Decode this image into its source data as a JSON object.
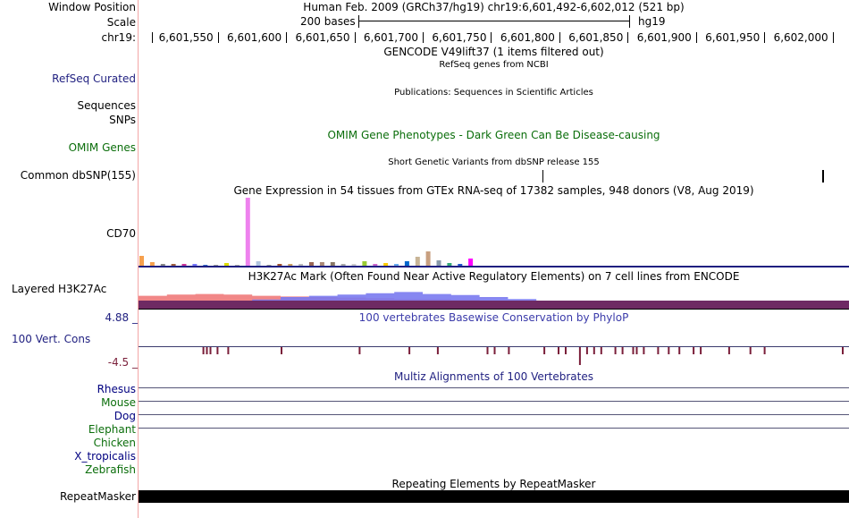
{
  "header": {
    "window_position_label": "Window Position",
    "window_position_value": "Human Feb. 2009 (GRCh37/hg19)   chr19:6,601,492-6,602,012 (521 bp)",
    "scale_label": "Scale",
    "scale_text": "200 bases",
    "scale_assembly": "hg19",
    "chrom_label": "chr19:",
    "ticks": [
      {
        "pos": 6601550,
        "label": "6,601,550"
      },
      {
        "pos": 6601600,
        "label": "6,601,600"
      },
      {
        "pos": 6601650,
        "label": "6,601,650"
      },
      {
        "pos": 6601700,
        "label": "6,601,700"
      },
      {
        "pos": 6601750,
        "label": "6,601,750"
      },
      {
        "pos": 6601800,
        "label": "6,601,800"
      },
      {
        "pos": 6601850,
        "label": "6,601,850"
      },
      {
        "pos": 6601900,
        "label": "6,601,900"
      },
      {
        "pos": 6601950,
        "label": "6,601,950"
      },
      {
        "pos": 6602000,
        "label": "6,602,000"
      }
    ]
  },
  "tracks": {
    "gencode_title": "GENCODE V49lift37 (1 items filtered out)",
    "refseq_title": "RefSeq genes from NCBI",
    "refseq_label": "RefSeq Curated",
    "publications_title": "Publications: Sequences in Scientific Articles",
    "sequences_label": "Sequences",
    "snps_label": "SNPs",
    "omim_title": "OMIM Gene Phenotypes - Dark Green Can Be Disease-causing",
    "omim_label": "OMIM Genes",
    "dbsnp_title": "Short Genetic Variants from dbSNP release 155",
    "dbsnp_label": "Common dbSNP(155)",
    "gtex_title": "Gene Expression in 54 tissues from GTEx RNA-seq of 17382 samples, 948 donors (V8, Aug 2019)",
    "gtex_label": "CD70",
    "h3k27ac_title": "H3K27Ac Mark (Often Found Near Active Regulatory Elements) on 7 cell lines from ENCODE",
    "h3k27ac_label": "Layered H3K27Ac",
    "cons_title": "100 vertebrates Basewise Conservation by PhyloP",
    "cons_label": "100 Vert. Cons",
    "cons_max": "4.88 _",
    "cons_min": "-4.5 _",
    "multiz_title": "Multiz Alignments of 100 Vertebrates",
    "species": [
      {
        "name": "Rhesus",
        "color": "#000080",
        "line": true
      },
      {
        "name": "Mouse",
        "color": "#0b6e0b",
        "line": true
      },
      {
        "name": "Dog",
        "color": "#000080",
        "line": true
      },
      {
        "name": "Elephant",
        "color": "#0b6e0b",
        "line": true
      },
      {
        "name": "Chicken",
        "color": "#0b6e0b",
        "line": false
      },
      {
        "name": "X_tropicalis",
        "color": "#000080",
        "line": false
      },
      {
        "name": "Zebrafish",
        "color": "#0b6e0b",
        "line": false
      }
    ],
    "repeat_title": "Repeating Elements by RepeatMasker",
    "repeat_label": "RepeatMasker"
  },
  "colors": {
    "navy_label": "#1f1f80",
    "green_label": "#0b6e0b",
    "conservation": "#3b3baa",
    "h3k27ac_red": "#f07a7a",
    "h3k27ac_blue": "#7a7af0",
    "h3k27ac_dark": "#6e2a63"
  },
  "gtex_bars": [
    {
      "v": 11,
      "c": "#f6a04d"
    },
    {
      "v": 4,
      "c": "#f6a04d"
    },
    {
      "v": 2,
      "c": "#888888"
    },
    {
      "v": 2,
      "c": "#a06040"
    },
    {
      "v": 2,
      "c": "#cc3399"
    },
    {
      "v": 2,
      "c": "#7777ff"
    },
    {
      "v": 1,
      "c": "#3366cc"
    },
    {
      "v": 1,
      "c": "#999999"
    },
    {
      "v": 3,
      "c": "#dddd00"
    },
    {
      "v": 1,
      "c": "#aaaaaa"
    },
    {
      "v": 76,
      "c": "#ee82ee"
    },
    {
      "v": 5,
      "c": "#b0c4de"
    },
    {
      "v": 1,
      "c": "#999999"
    },
    {
      "v": 2,
      "c": "#a0522d"
    },
    {
      "v": 2,
      "c": "#c8a060"
    },
    {
      "v": 2,
      "c": "#bbbbbb"
    },
    {
      "v": 4,
      "c": "#996655"
    },
    {
      "v": 4,
      "c": "#aa8877"
    },
    {
      "v": 4,
      "c": "#887766"
    },
    {
      "v": 2,
      "c": "#aaaaaa"
    },
    {
      "v": 2,
      "c": "#cccccc"
    },
    {
      "v": 5,
      "c": "#99cc33"
    },
    {
      "v": 2,
      "c": "#cc66cc"
    },
    {
      "v": 3,
      "c": "#ffcc00"
    },
    {
      "v": 2,
      "c": "#66aaee"
    },
    {
      "v": 5,
      "c": "#0066cc"
    },
    {
      "v": 10,
      "c": "#c8b496"
    },
    {
      "v": 16,
      "c": "#c8a080"
    },
    {
      "v": 6,
      "c": "#8899aa"
    },
    {
      "v": 3,
      "c": "#33aa77"
    },
    {
      "v": 2,
      "c": "#2255cc"
    },
    {
      "v": 8,
      "c": "#ff00ff"
    }
  ],
  "h3k27ac_red_profile": [
    0.55,
    0.6,
    0.62,
    0.6,
    0.55,
    0.52,
    0.5,
    0.48,
    0.45,
    0.42,
    0.42,
    0.4,
    0.35,
    0.3,
    0.28,
    0.26,
    0.25,
    0.24,
    0.22,
    0.22,
    0.2,
    0.18,
    0.2,
    0.22,
    0.2
  ],
  "h3k27ac_blue_profile": [
    0.2,
    0.25,
    0.3,
    0.35,
    0.4,
    0.5,
    0.55,
    0.6,
    0.65,
    0.7,
    0.62,
    0.58,
    0.5,
    0.42,
    0.32,
    0.25,
    0.2,
    0.18,
    0.16,
    0.15,
    0.15,
    0.15,
    0.15,
    0.15,
    0.15
  ],
  "cons_ticks": [
    0.09,
    0.095,
    0.1,
    0.11,
    0.125,
    0.2,
    0.31,
    0.38,
    0.42,
    0.49,
    0.5,
    0.57,
    0.6,
    0.63,
    0.65,
    0.64,
    0.67,
    0.68,
    0.71,
    0.73,
    0.745,
    0.76,
    0.79,
    0.78,
    0.83,
    0.86,
    0.88,
    0.99,
    0.52,
    0.59,
    0.62,
    0.695,
    0.7
  ]
}
